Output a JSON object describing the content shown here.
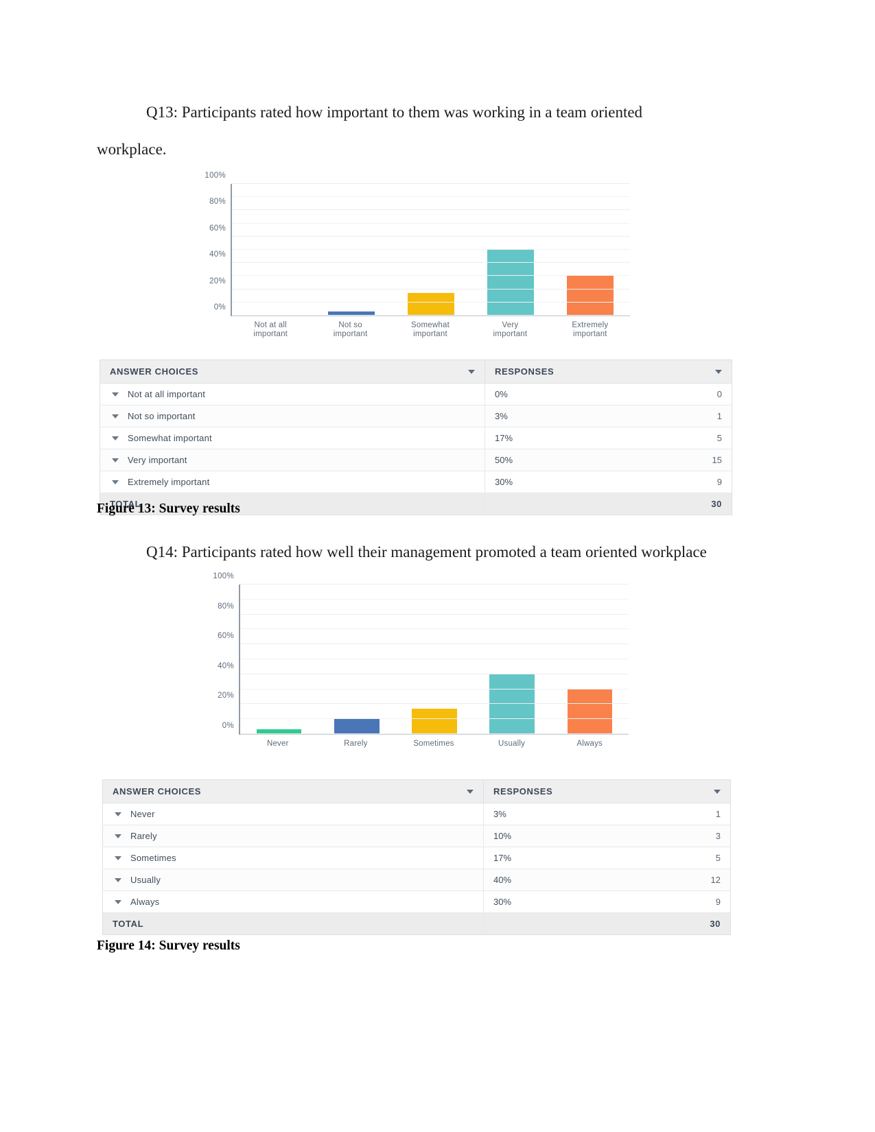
{
  "document": {
    "q13_paragraph": "Q13: Participants rated how important to them was working in a team oriented workplace.",
    "q13_line1": "Q13: Participants rated how important to them was working in a team oriented",
    "q13_line2": "workplace.",
    "figure13_caption": "Figure 13: Survey results",
    "q14_paragraph": "Q14: Participants rated how well their management promoted a team oriented workplace",
    "figure14_caption": "Figure 14: Survey results"
  },
  "colors": {
    "green": "#2ecc8f",
    "blue": "#4a76b8",
    "yellow": "#f5bc0c",
    "teal": "#63c5c6",
    "orange": "#f9814b",
    "grid": "#f0f2f4",
    "axis": "#8e9aa6",
    "header_bg": "#efefef",
    "text": "#3f4c5a"
  },
  "chart_data": [
    {
      "type": "bar",
      "title": "",
      "xlabel": "",
      "ylabel": "",
      "ylim": [
        0,
        100
      ],
      "yticks": [
        "0%",
        "20%",
        "40%",
        "60%",
        "80%",
        "100%"
      ],
      "ytick_values": [
        0,
        20,
        40,
        60,
        80,
        100
      ],
      "grid": true,
      "legend": "none",
      "categories": [
        "Not at all important",
        "Not so important",
        "Somewhat important",
        "Very important",
        "Extremely important"
      ],
      "category_lines": [
        [
          "Not at all",
          "important"
        ],
        [
          "Not so",
          "important"
        ],
        [
          "Somewhat",
          "important"
        ],
        [
          "Very",
          "important"
        ],
        [
          "Extremely",
          "important"
        ]
      ],
      "values": [
        0,
        3,
        17,
        50,
        30
      ],
      "bar_colors": [
        "#2ecc8f",
        "#4a76b8",
        "#f5bc0c",
        "#63c5c6",
        "#f9814b"
      ]
    },
    {
      "type": "bar",
      "title": "",
      "xlabel": "",
      "ylabel": "",
      "ylim": [
        0,
        100
      ],
      "yticks": [
        "0%",
        "20%",
        "40%",
        "60%",
        "80%",
        "100%"
      ],
      "ytick_values": [
        0,
        20,
        40,
        60,
        80,
        100
      ],
      "grid": true,
      "legend": "none",
      "categories": [
        "Never",
        "Rarely",
        "Sometimes",
        "Usually",
        "Always"
      ],
      "category_lines": [
        [
          "Never",
          ""
        ],
        [
          "Rarely",
          ""
        ],
        [
          "Sometimes",
          ""
        ],
        [
          "Usually",
          ""
        ],
        [
          "Always",
          ""
        ]
      ],
      "values": [
        3,
        10,
        17,
        40,
        30
      ],
      "bar_colors": [
        "#2ecc8f",
        "#4a76b8",
        "#f5bc0c",
        "#63c5c6",
        "#f9814b"
      ]
    }
  ],
  "table13": {
    "headers": {
      "choices": "ANSWER CHOICES",
      "responses": "RESPONSES"
    },
    "rows": [
      {
        "choice": "Not at all important",
        "pct": "0%",
        "count": "0"
      },
      {
        "choice": "Not so important",
        "pct": "3%",
        "count": "1"
      },
      {
        "choice": "Somewhat important",
        "pct": "17%",
        "count": "5"
      },
      {
        "choice": "Very important",
        "pct": "50%",
        "count": "15"
      },
      {
        "choice": "Extremely important",
        "pct": "30%",
        "count": "9"
      }
    ],
    "total_label": "TOTAL",
    "total_count": "30"
  },
  "table14": {
    "headers": {
      "choices": "ANSWER CHOICES",
      "responses": "RESPONSES"
    },
    "rows": [
      {
        "choice": "Never",
        "pct": "3%",
        "count": "1"
      },
      {
        "choice": "Rarely",
        "pct": "10%",
        "count": "3"
      },
      {
        "choice": "Sometimes",
        "pct": "17%",
        "count": "5"
      },
      {
        "choice": "Usually",
        "pct": "40%",
        "count": "12"
      },
      {
        "choice": "Always",
        "pct": "30%",
        "count": "9"
      }
    ],
    "total_label": "TOTAL",
    "total_count": "30"
  }
}
